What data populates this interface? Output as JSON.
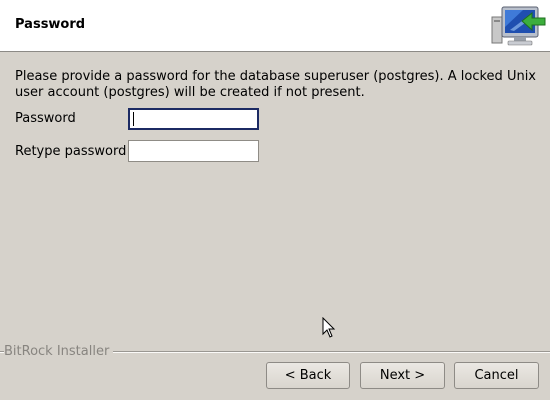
{
  "header": {
    "title": "Password"
  },
  "main": {
    "description": "Please provide a password for the database superuser (postgres). A locked Unix user account (postgres) will be created if not present.",
    "password_label": "Password",
    "password_value": "",
    "retype_label": "Retype password",
    "retype_value": ""
  },
  "footer": {
    "brand": "BitRock Installer",
    "back_label": "< Back",
    "next_label": "Next >",
    "cancel_label": "Cancel"
  },
  "icons": {
    "logo": "computer-install-icon",
    "cursor": "mouse-pointer-icon"
  },
  "colors": {
    "background": "#d6d2cb",
    "header_background": "#ffffff",
    "focus_border": "#1c2a63"
  }
}
